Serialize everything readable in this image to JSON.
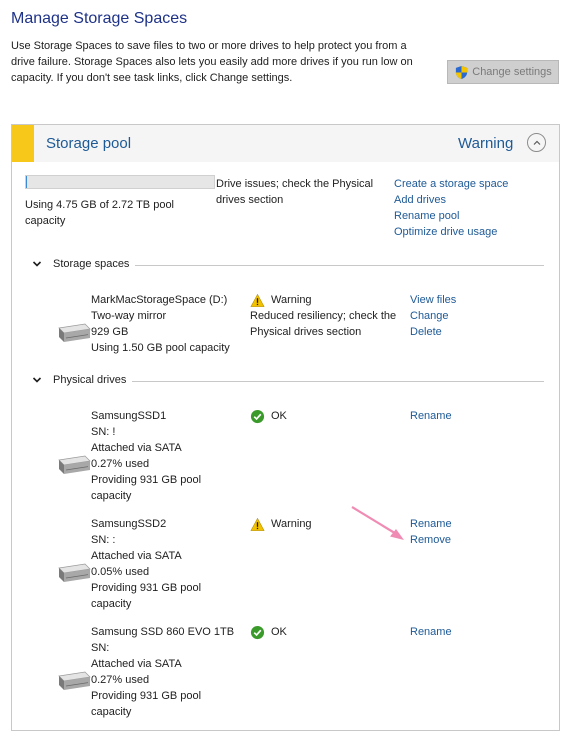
{
  "page": {
    "title": "Manage Storage Spaces",
    "intro": "Use Storage Spaces to save files to two or more drives to help protect you from a drive failure. Storage Spaces also lets you easily add more drives if you run low on capacity. If you don't see task links, click Change settings.",
    "change_settings_label": "Change settings"
  },
  "pool": {
    "title": "Storage pool",
    "status": "Warning",
    "usage_fraction": 0.0017,
    "usage_text": "Using 4.75 GB of 2.72 TB pool capacity",
    "issue_text": "Drive issues; check the Physical drives section",
    "links": [
      "Create a storage space",
      "Add drives",
      "Rename pool",
      "Optimize drive usage"
    ]
  },
  "sections": {
    "storage_spaces": "Storage spaces",
    "physical_drives": "Physical drives"
  },
  "space": {
    "name": "MarkMacStorageSpace (D:)",
    "type": "Two-way mirror",
    "size": "929 GB",
    "usage": "Using 1.50 GB pool capacity",
    "status": "Warning",
    "status_detail": "Reduced resiliency; check the Physical drives section",
    "links": [
      "View files",
      "Change",
      "Delete"
    ]
  },
  "drives": [
    {
      "name": "SamsungSSD1",
      "sn": "SN: !",
      "attach": "Attached via SATA",
      "used": "0.27% used",
      "providing": "Providing 931 GB pool capacity",
      "status": "OK",
      "links": [
        "Rename"
      ]
    },
    {
      "name": "SamsungSSD2",
      "sn": "SN: :",
      "attach": "Attached via SATA",
      "used": "0.05% used",
      "providing": "Providing 931 GB pool capacity",
      "status": "Warning",
      "links": [
        "Rename",
        "Remove"
      ]
    },
    {
      "name": "Samsung SSD 860 EVO 1TB",
      "sn": "SN:",
      "attach": "Attached via SATA",
      "used": "0.27% used",
      "providing": "Providing 931 GB pool capacity",
      "status": "OK",
      "links": [
        "Rename"
      ]
    }
  ],
  "colors": {
    "link": "#1e5a96",
    "warning_bar": "#f7c81a",
    "ok_green": "#3a9a2a",
    "warning_yellow": "#f2c100",
    "arrow_pink": "#f08cb4"
  },
  "icons": {
    "shield": "uac-shield-icon",
    "warning": "warning-icon",
    "ok": "ok-check-icon",
    "drive": "drive-icon",
    "chevron": "chevron-down-icon",
    "collapse": "chevron-up-icon"
  }
}
